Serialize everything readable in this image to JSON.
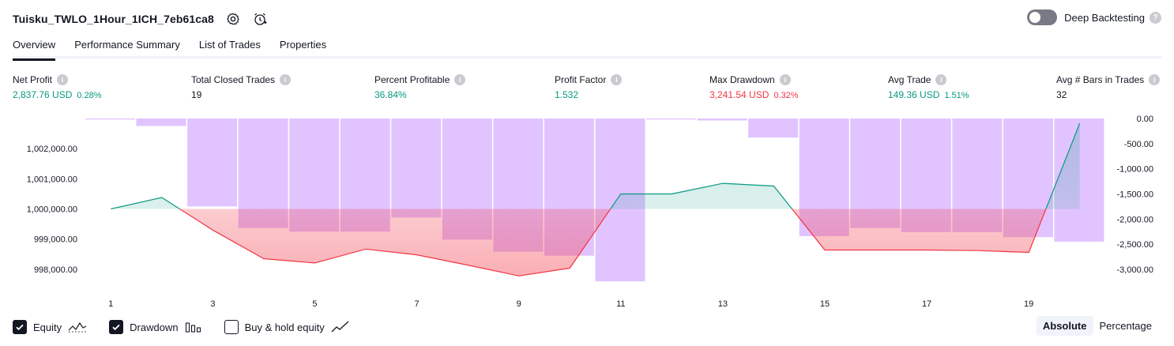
{
  "header": {
    "strategy_name": "Tuisku_TWLO_1Hour_1ICH_7eb61ca8",
    "deep_backtesting_label": "Deep Backtesting",
    "deep_backtesting_enabled": false
  },
  "tabs": [
    {
      "label": "Overview",
      "active": true
    },
    {
      "label": "Performance Summary",
      "active": false
    },
    {
      "label": "List of Trades",
      "active": false
    },
    {
      "label": "Properties",
      "active": false
    }
  ],
  "stats": {
    "net_profit": {
      "title": "Net Profit",
      "value": "2,837.76 USD",
      "pct": "0.28%"
    },
    "total_closed_trades": {
      "title": "Total Closed Trades",
      "value": "19"
    },
    "percent_profitable": {
      "title": "Percent Profitable",
      "value": "36.84%"
    },
    "profit_factor": {
      "title": "Profit Factor",
      "value": "1.532"
    },
    "max_drawdown": {
      "title": "Max Drawdown",
      "value": "3,241.54 USD",
      "pct": "0.32%"
    },
    "avg_trade": {
      "title": "Avg Trade",
      "value": "149.36 USD",
      "pct": "1.51%"
    },
    "avg_bars": {
      "title": "Avg # Bars in Trades",
      "value": "32"
    }
  },
  "legend": {
    "equity": {
      "label": "Equity",
      "checked": true
    },
    "drawdown": {
      "label": "Drawdown",
      "checked": true
    },
    "buy_hold": {
      "label": "Buy & hold equity",
      "checked": false
    }
  },
  "modes": {
    "absolute": "Absolute",
    "percentage": "Percentage",
    "active": "absolute"
  },
  "colors": {
    "equity_up": "#089981",
    "equity_down": "#f23645",
    "drawdown_bar": "#e1c4ff",
    "text": "#131722"
  },
  "chart_data": {
    "type": "line",
    "x": [
      1,
      2,
      3,
      4,
      5,
      6,
      7,
      8,
      9,
      10,
      11,
      12,
      13,
      14,
      15,
      16,
      17,
      18,
      19,
      20
    ],
    "x_tick_labels": [
      "1",
      "3",
      "5",
      "7",
      "9",
      "11",
      "13",
      "15",
      "17",
      "19"
    ],
    "series": [
      {
        "axis": "left",
        "values": [
          1000000.0,
          1000380.0,
          999300.0,
          998350.0,
          998210.0,
          998670.0,
          998480.0,
          998140.0,
          997780.0,
          998040.0,
          1000500.0,
          1000500.0,
          1000850.0,
          1000760.0,
          998640.0,
          998640.0,
          998640.0,
          998620.0,
          998560.0,
          1002840.0
        ]
      },
      {
        "axis": "right",
        "values": [
          -20.0,
          -150.0,
          -1750.0,
          -2180.0,
          -2250.0,
          -2250.0,
          -1970.0,
          -2410.0,
          -2650.0,
          -2730.0,
          -3240.0,
          -20.0,
          -40.0,
          -380.0,
          -2340.0,
          -2180.0,
          -2260.0,
          -2260.0,
          -2360.0,
          -2450.0
        ]
      }
    ],
    "y_left": {
      "ticks": [
        "1,002,000.00",
        "1,001,000.00",
        "1,000,000.00",
        "999,000.00",
        "998,000.00"
      ],
      "min": 997500.0,
      "max": 1003000.0
    },
    "y_right": {
      "ticks": [
        "0.00",
        "-500.00",
        "-1,000.00",
        "-1,500.00",
        "-2,000.00",
        "-2,500.00",
        "-3,000.00"
      ],
      "min": -3300.0,
      "max": 0.0
    },
    "baseline": 1000000.0
  }
}
